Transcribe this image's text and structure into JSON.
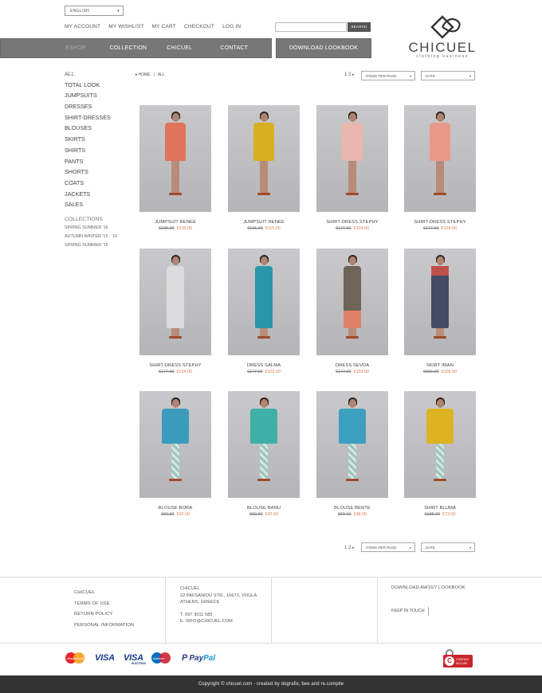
{
  "header": {
    "language": "ENGLISH",
    "top_links": [
      "MY ACCOUNT",
      "MY WISHLIST",
      "MY CART",
      "CHECKOUT",
      "LOG IN"
    ],
    "search_placeholder": "",
    "search_button": "SEARCH",
    "logo_text": "CHICUEL",
    "logo_tagline": "clothing business"
  },
  "nav": {
    "items": [
      "ESHOP",
      "COLLECTION",
      "CHICUEL",
      "CONTACT"
    ],
    "lookbook": "DOWNLOAD LOOKBOOK"
  },
  "sidebar": {
    "categories": [
      "ALL",
      "TOTAL LOOK",
      "JUMPSUITS",
      "DRESSES",
      "SHIRT-DRESSES",
      "BLOUSES",
      "SKIRTS",
      "SHIRTS",
      "PANTS",
      "SHORTS",
      "COATS",
      "JACKETS",
      "SALES"
    ],
    "collections_heading": "COLLECTIONS",
    "collections": [
      "SPRING SUMMER '16",
      "AUTUMN WINTER '15 - '16",
      "SPRING SUMMER '15"
    ]
  },
  "breadcrumb": [
    "HOME",
    "ALL"
  ],
  "toolbar": {
    "pages": "1 2",
    "items_per_page": "ITEMS PER PAGE",
    "sort": "DATE"
  },
  "products": [
    {
      "name": "JUMPSUIT RENEE",
      "old_price": "€195.00",
      "new_price": "€136.00",
      "color": "#e0735a"
    },
    {
      "name": "JUMPSUIT RENEE",
      "old_price": "€165.00",
      "new_price": "€115.00",
      "color": "#d9b022"
    },
    {
      "name": "SHIRT-DRESS STEPHY",
      "old_price": "€177.00",
      "new_price": "€124.00",
      "color": "#e8b7b0"
    },
    {
      "name": "SHIRT-DRESS STEPHY",
      "old_price": "€177.00",
      "new_price": "€124.00",
      "color": "#e89a8a"
    },
    {
      "name": "SHIRT-DRESS STEPHY",
      "old_price": "€177.00",
      "new_price": "€124.00",
      "color": "#dcdcdc"
    },
    {
      "name": "DRESS SALMA",
      "old_price": "€147.00",
      "new_price": "€103.00",
      "color": "#2a96a8"
    },
    {
      "name": "DRESS SEVDA",
      "old_price": "€147.00",
      "new_price": "€103.00",
      "color": "#6e6458"
    },
    {
      "name": "SKIRT IMAN",
      "old_price": "€156.00",
      "new_price": "€109.00",
      "color": "#444c63"
    },
    {
      "name": "BLOUSE BORA",
      "old_price": "€60.00",
      "new_price": "€42.00",
      "color": "#3b9bbd"
    },
    {
      "name": "BLOUSE BANU",
      "old_price": "€60.00",
      "new_price": "€42.00",
      "color": "#3fb0a8"
    },
    {
      "name": "BLOUSE BENTE",
      "old_price": "€69.00",
      "new_price": "€48.00",
      "color": "#3d9fc0"
    },
    {
      "name": "SHIRT BLUMA",
      "old_price": "€105.00",
      "new_price": "€73.00",
      "color": "#ddb323"
    }
  ],
  "footer": {
    "links": [
      "CHICUEL",
      "TERMS OF USE",
      "RETURN POLICY",
      "PERSONAL INFORMATION"
    ],
    "address": [
      "CHICUEL",
      "22 PAFSANIOU STR., 15673, VOULA",
      "ATHENS, GREECE",
      "",
      "T. 697 3011 585",
      "E. INFO@CHICUEL.COM"
    ],
    "download": "DOWNLOAD AW16/7 LOOKBOOK",
    "keep_in_touch": "KEEP IN TOUCH"
  },
  "payments": {
    "mastercard": "MasterCard",
    "visa": "VISA",
    "visa_electron": "VISA",
    "visa_electron_sub": "ELECTRON",
    "maestro": "Maestro",
    "paypal_1": "Pay",
    "paypal_2": "Pal",
    "secure_line1": "COMODO",
    "secure_line2": "SECURE"
  },
  "copyright": "Copyright © chicuel.com - created by dografix, bee and re.compile"
}
